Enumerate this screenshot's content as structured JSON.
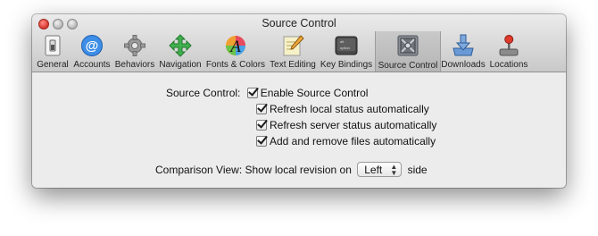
{
  "window": {
    "title": "Source Control"
  },
  "toolbar": {
    "items": [
      {
        "label": "General",
        "icon": "general-switch-icon"
      },
      {
        "label": "Accounts",
        "icon": "at-sign-icon"
      },
      {
        "label": "Behaviors",
        "icon": "gear-icon"
      },
      {
        "label": "Navigation",
        "icon": "navigation-arrows-icon"
      },
      {
        "label": "Fonts & Colors",
        "icon": "font-colors-icon"
      },
      {
        "label": "Text Editing",
        "icon": "notepad-pencil-icon"
      },
      {
        "label": "Key Bindings",
        "icon": "keyboard-key-icon"
      },
      {
        "label": "Source Control",
        "icon": "source-control-icon"
      },
      {
        "label": "Downloads",
        "icon": "download-tray-icon"
      },
      {
        "label": "Locations",
        "icon": "joystick-icon"
      }
    ],
    "selected": "Source Control"
  },
  "source_control": {
    "label": "Source Control:",
    "enable": {
      "label": "Enable Source Control",
      "checked": true
    },
    "options": [
      {
        "label": "Refresh local status automatically",
        "checked": true
      },
      {
        "label": "Refresh server status automatically",
        "checked": true
      },
      {
        "label": "Add and remove files automatically",
        "checked": true
      }
    ]
  },
  "comparison": {
    "label": "Comparison View:",
    "prefix": "Show local revision on",
    "selected": "Left",
    "suffix": "side"
  }
}
